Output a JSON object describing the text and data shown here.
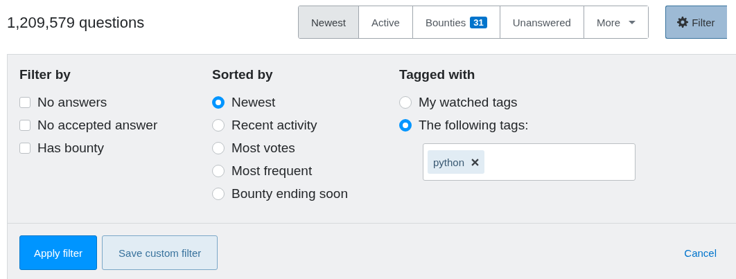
{
  "question_count": "1,209,579 questions",
  "tabs": [
    {
      "label": "Newest",
      "selected": true
    },
    {
      "label": "Active",
      "selected": false
    },
    {
      "label": "Bounties",
      "badge": "31",
      "selected": false
    },
    {
      "label": "Unanswered",
      "selected": false
    },
    {
      "label": "More",
      "dropdown": true,
      "selected": false
    }
  ],
  "filter_button": {
    "label": "Filter",
    "pressed": true
  },
  "filter_panel": {
    "filter_by": {
      "title": "Filter by",
      "options": [
        {
          "label": "No answers",
          "checked": false
        },
        {
          "label": "No accepted answer",
          "checked": false
        },
        {
          "label": "Has bounty",
          "checked": false
        }
      ]
    },
    "sorted_by": {
      "title": "Sorted by",
      "options": [
        {
          "label": "Newest",
          "selected": true
        },
        {
          "label": "Recent activity",
          "selected": false
        },
        {
          "label": "Most votes",
          "selected": false
        },
        {
          "label": "Most frequent",
          "selected": false
        },
        {
          "label": "Bounty ending soon",
          "selected": false
        }
      ]
    },
    "tagged_with": {
      "title": "Tagged with",
      "options": [
        {
          "label": "My watched tags",
          "selected": false
        },
        {
          "label": "The following tags:",
          "selected": true
        }
      ],
      "tags": [
        "python"
      ]
    },
    "buttons": [
      {
        "label": "Apply filter",
        "kind": "primary"
      },
      {
        "label": "Save custom filter",
        "kind": "secondary"
      },
      {
        "label": "Cancel",
        "kind": "link"
      }
    ]
  }
}
